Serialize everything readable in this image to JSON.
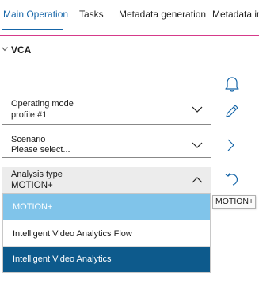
{
  "tabs": [
    {
      "label": "Main Operation"
    },
    {
      "label": "Tasks"
    },
    {
      "label": "Metadata generation"
    },
    {
      "label": "Metadata ins"
    }
  ],
  "section": {
    "title": "VCA"
  },
  "fields": {
    "operating_mode": {
      "label": "Operating mode",
      "value": "profile #1"
    },
    "scenario": {
      "label": "Scenario",
      "value": "Please select..."
    },
    "analysis_type": {
      "label": "Analysis type",
      "value": "MOTION+"
    }
  },
  "dropdown": {
    "options": [
      {
        "label": "MOTION+"
      },
      {
        "label": "Intelligent Video Analytics Flow"
      },
      {
        "label": "Intelligent Video Analytics"
      }
    ]
  },
  "tooltip": {
    "text": "MOTION+"
  },
  "icons": [
    "bell-icon",
    "pencil-icon",
    "chevron-right-icon",
    "undo-icon"
  ],
  "colors": {
    "active_tab": "#1565a8",
    "tab_border": "#d63a8a",
    "hover_option": "#80c4ea",
    "selected_option": "#0d5a8c"
  }
}
